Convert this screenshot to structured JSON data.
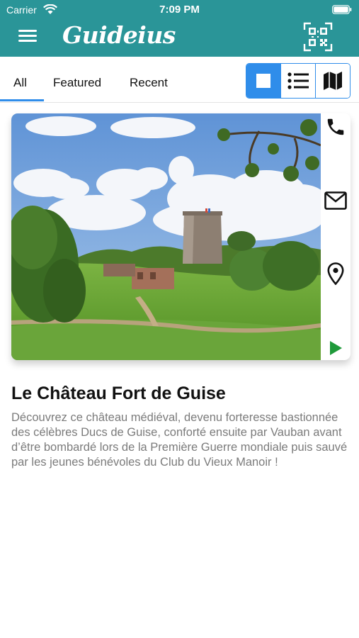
{
  "status_bar": {
    "carrier": "Carrier",
    "time": "7:09 PM"
  },
  "app": {
    "logo_text": "Guideius",
    "header_color": "#2a9598",
    "accent_color": "#2f8dea"
  },
  "tabs": [
    {
      "label": "All",
      "selected": true
    },
    {
      "label": "Featured",
      "selected": false
    },
    {
      "label": "Recent",
      "selected": false
    }
  ],
  "view_modes": [
    {
      "icon": "square-icon",
      "selected": true
    },
    {
      "icon": "list-icon",
      "selected": false
    },
    {
      "icon": "map-icon",
      "selected": false
    }
  ],
  "place": {
    "title": "Le Château Fort de Guise",
    "description": "Découvrez ce château médiéval, devenu forteresse bastionnée des célèbres Ducs de Guise, conforté ensuite par Vauban avant d’être bombardé lors de la Première Guerre mondiale puis sauvé par les jeunes bénévoles du Club du Vieux Manoir !",
    "actions": [
      "phone-icon",
      "mail-icon",
      "location-pin-icon",
      "play-icon"
    ],
    "play_color": "#1f9a3a"
  }
}
